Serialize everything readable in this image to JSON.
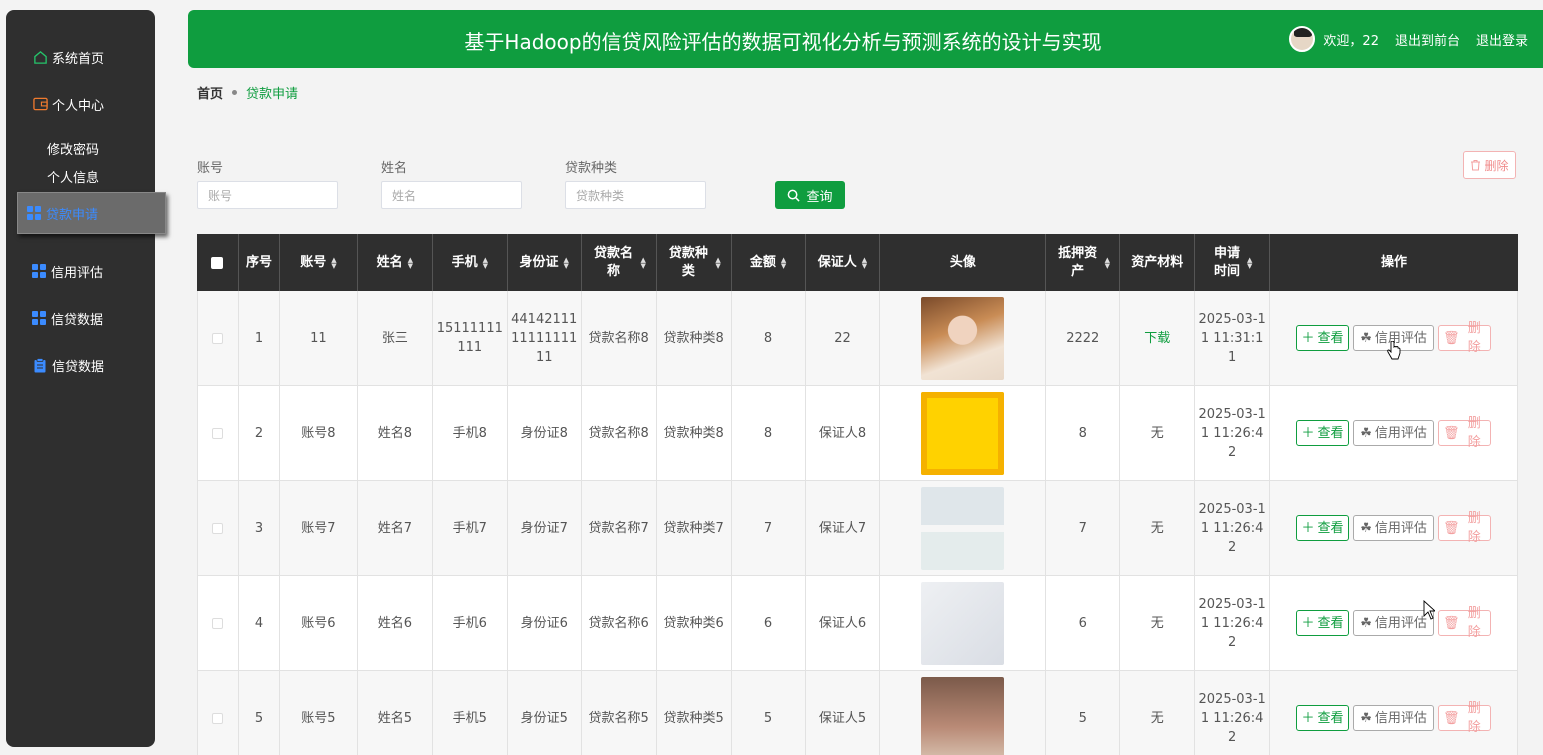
{
  "sidebar": {
    "items": [
      {
        "label": "系统首页",
        "icon": "home-icon"
      },
      {
        "label": "个人中心",
        "icon": "wallet-icon"
      },
      {
        "label": "修改密码"
      },
      {
        "label": "个人信息"
      },
      {
        "label": "贷款申请",
        "icon": "grid-icon"
      },
      {
        "label": "信用评估",
        "icon": "grid-icon"
      },
      {
        "label": "信贷数据",
        "icon": "grid-icon"
      },
      {
        "label": "信贷数据",
        "icon": "clipboard-icon"
      }
    ]
  },
  "header": {
    "title": "基于Hadoop的信贷风险评估的数据可视化分析与预测系统的设计与实现",
    "welcome": "欢迎，22",
    "front_link": "退出到前台",
    "logout_link": "退出登录"
  },
  "breadcrumb": {
    "home": "首页",
    "current": "贷款申请"
  },
  "search": {
    "account_label": "账号",
    "account_placeholder": "账号",
    "name_label": "姓名",
    "name_placeholder": "姓名",
    "type_label": "贷款种类",
    "type_placeholder": "贷款种类",
    "query_label": "查询",
    "delete_label": "删除"
  },
  "table": {
    "headers": [
      "序号",
      "账号",
      "姓名",
      "手机",
      "身份证",
      "贷款名称",
      "贷款种类",
      "金额",
      "保证人",
      "头像",
      "抵押资产",
      "资产材料",
      "申请时间",
      "操作"
    ],
    "actions": {
      "view": "查看",
      "credit": "信用评估",
      "delete": "删除"
    },
    "rows": [
      {
        "no": "1",
        "account": "11",
        "name": "张三",
        "phone": "15111111111",
        "idcard": "441421111111111111",
        "loan_name": "贷款名称8",
        "loan_type": "贷款种类8",
        "amount": "8",
        "guarantor": "22",
        "asset": "2222",
        "material": "下载",
        "time": "2025-03-11 11:31:11"
      },
      {
        "no": "2",
        "account": "账号8",
        "name": "姓名8",
        "phone": "手机8",
        "idcard": "身份证8",
        "loan_name": "贷款名称8",
        "loan_type": "贷款种类8",
        "amount": "8",
        "guarantor": "保证人8",
        "asset": "8",
        "material": "无",
        "time": "2025-03-11 11:26:42"
      },
      {
        "no": "3",
        "account": "账号7",
        "name": "姓名7",
        "phone": "手机7",
        "idcard": "身份证7",
        "loan_name": "贷款名称7",
        "loan_type": "贷款种类7",
        "amount": "7",
        "guarantor": "保证人7",
        "asset": "7",
        "material": "无",
        "time": "2025-03-11 11:26:42"
      },
      {
        "no": "4",
        "account": "账号6",
        "name": "姓名6",
        "phone": "手机6",
        "idcard": "身份证6",
        "loan_name": "贷款名称6",
        "loan_type": "贷款种类6",
        "amount": "6",
        "guarantor": "保证人6",
        "asset": "6",
        "material": "无",
        "time": "2025-03-11 11:26:42"
      },
      {
        "no": "5",
        "account": "账号5",
        "name": "姓名5",
        "phone": "手机5",
        "idcard": "身份证5",
        "loan_name": "贷款名称5",
        "loan_type": "贷款种类5",
        "amount": "5",
        "guarantor": "保证人5",
        "asset": "5",
        "material": "无",
        "time": "2025-03-11 11:26:42"
      }
    ]
  },
  "colors": {
    "brand": "#0f9d3f",
    "sidebar": "#2f2f2f",
    "accent": "#3b8bff",
    "danger": "#f3a0a0"
  }
}
